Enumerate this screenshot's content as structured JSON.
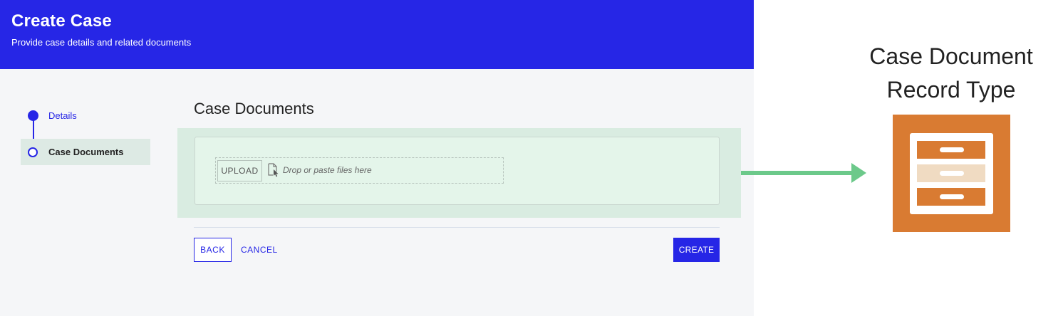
{
  "header": {
    "title": "Create Case",
    "subtitle": "Provide case details and related documents",
    "background_color": "#2626e6"
  },
  "stepper": {
    "steps": [
      {
        "label": "Details",
        "state": "completed"
      },
      {
        "label": "Case Documents",
        "state": "current"
      }
    ]
  },
  "main": {
    "section_title": "Case Documents",
    "upload": {
      "button_label": "UPLOAD",
      "icon": "file-cursor-icon",
      "drop_text": "Drop or paste files here"
    },
    "actions": {
      "back_label": "BACK",
      "cancel_label": "CANCEL",
      "create_label": "CREATE"
    }
  },
  "annotation": {
    "title_line1": "Case Document",
    "title_line2": "Record Type",
    "icon": "filing-cabinet-icon",
    "icon_color": "#d97b32",
    "arrow_color": "#6cc98a"
  }
}
